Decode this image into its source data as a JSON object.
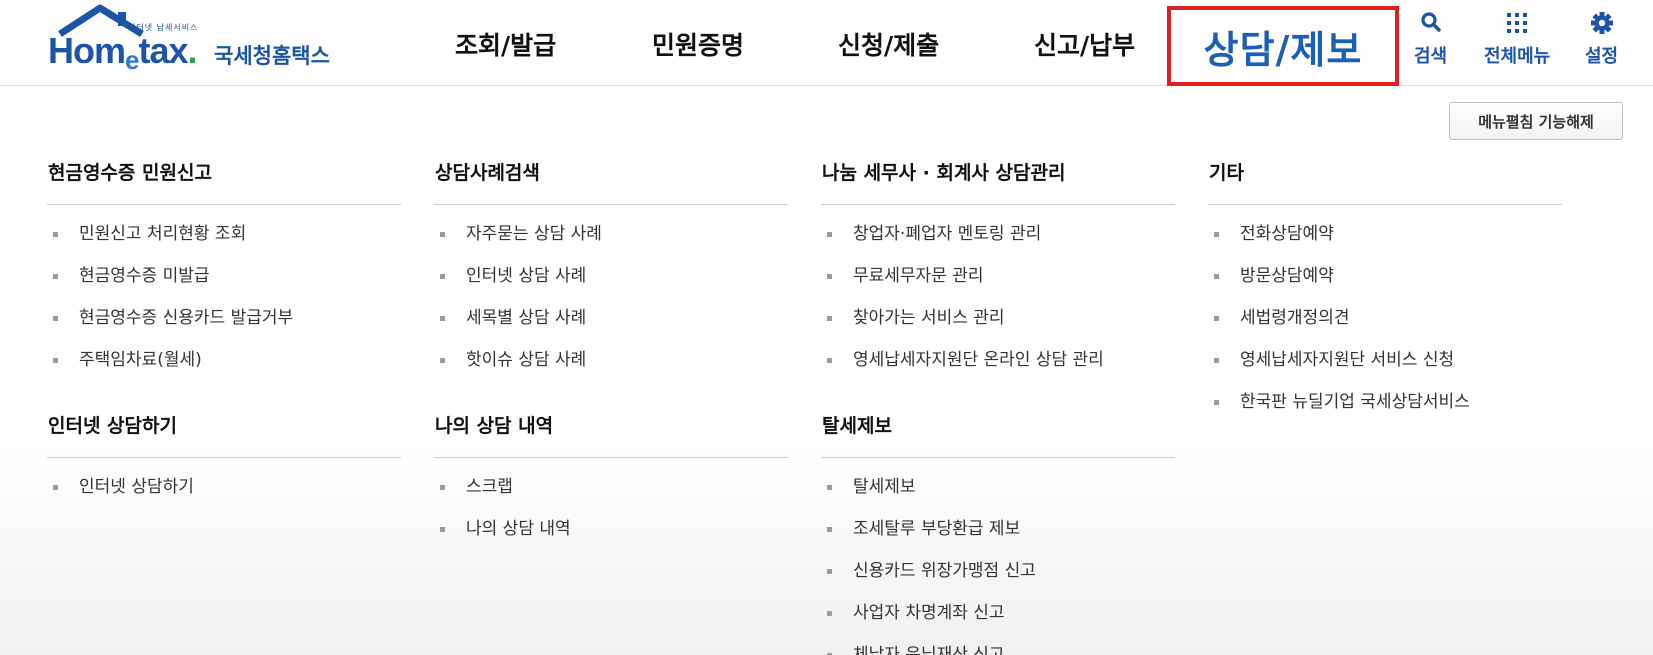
{
  "header": {
    "logo": {
      "brand": "Hometax",
      "tagline": "인터넷 납세서비스",
      "korean": "국세청홈택스"
    },
    "nav": [
      {
        "label": "조회/발급"
      },
      {
        "label": "민원증명"
      },
      {
        "label": "신청/제출"
      },
      {
        "label": "신고/납부"
      }
    ],
    "active_nav": "상담/제보",
    "utilities": {
      "search": "검색",
      "all_menu": "전체메뉴",
      "settings": "설정"
    }
  },
  "toggle_button": "메뉴펼침 기능해제",
  "columns": [
    {
      "sections": [
        {
          "title": "현금영수증 민원신고",
          "items": [
            "민원신고 처리현황 조회",
            "현금영수증 미발급",
            "현금영수증 신용카드 발급거부",
            "주택임차료(월세)"
          ]
        },
        {
          "title": "인터넷 상담하기",
          "items": [
            "인터넷 상담하기"
          ]
        }
      ]
    },
    {
      "sections": [
        {
          "title": "상담사례검색",
          "items": [
            "자주묻는 상담 사례",
            "인터넷 상담 사례",
            "세목별 상담 사례",
            "핫이슈 상담 사례"
          ]
        },
        {
          "title": "나의 상담 내역",
          "items": [
            "스크랩",
            "나의 상담 내역"
          ]
        }
      ]
    },
    {
      "sections": [
        {
          "title": "나눔 세무사 · 회계사 상담관리",
          "items": [
            "창업자·폐업자 멘토링 관리",
            "무료세무자문 관리",
            "찾아가는 서비스 관리",
            "영세납세자지원단 온라인 상담 관리"
          ]
        },
        {
          "title": "탈세제보",
          "items": [
            "탈세제보",
            "조세탈루 부당환급 제보",
            "신용카드 위장가맹점 신고",
            "사업자 차명계좌 신고",
            "체납자 은닉재산 신고"
          ]
        }
      ]
    },
    {
      "sections": [
        {
          "title": "기타",
          "items": [
            "전화상담예약",
            "방문상담예약",
            "세법령개정의견",
            "영세납세자지원단 서비스 신청",
            "한국판 뉴딜기업 국세상담서비스"
          ]
        }
      ]
    }
  ],
  "colors": {
    "brand_blue": "#1c55a8",
    "active_text": "#1c5fb8",
    "highlight_border": "#e02020"
  }
}
